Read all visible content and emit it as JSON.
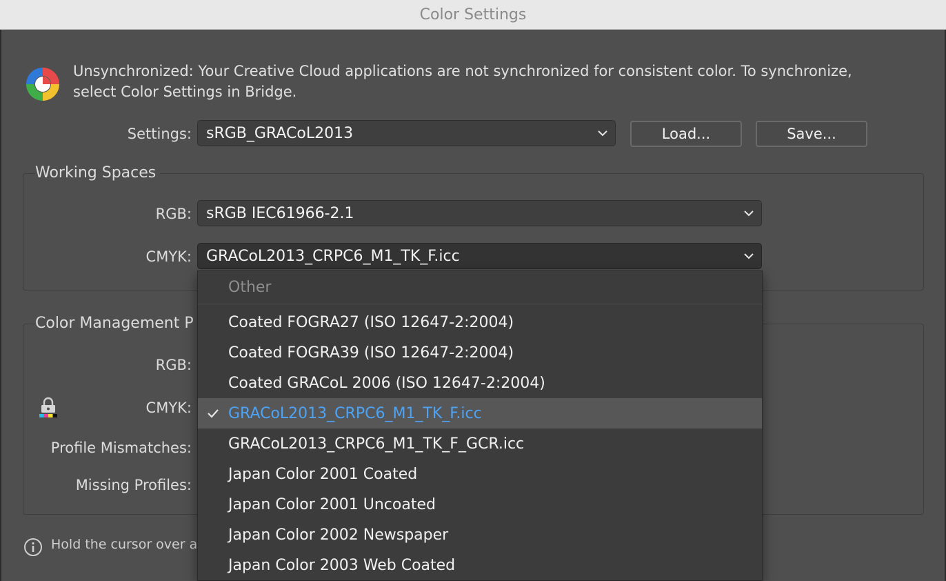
{
  "window": {
    "title": "Color Settings"
  },
  "sync": {
    "message": "Unsynchronized: Your Creative Cloud applications are not synchronized for consistent color. To synchronize, select Color Settings in Bridge."
  },
  "settings": {
    "label": "Settings:",
    "value": "sRGB_GRACoL2013",
    "load_label": "Load...",
    "save_label": "Save..."
  },
  "working_spaces": {
    "title": "Working Spaces",
    "rgb_label": "RGB:",
    "rgb_value": "sRGB IEC61966-2.1",
    "cmyk_label": "CMYK:",
    "cmyk_value": "GRACoL2013_CRPC6_M1_TK_F.icc"
  },
  "color_management": {
    "title": "Color Management P",
    "rgb_label": "RGB:",
    "cmyk_label": "CMYK:",
    "profile_mismatches_label": "Profile Mismatches:",
    "missing_profiles_label": "Missing Profiles:"
  },
  "info": {
    "text": "Hold the cursor over a"
  },
  "dropdown": {
    "header": "Other",
    "items": [
      {
        "label": "Coated FOGRA27 (ISO 12647-2:2004)",
        "selected": false
      },
      {
        "label": "Coated FOGRA39 (ISO 12647-2:2004)",
        "selected": false
      },
      {
        "label": "Coated GRACoL 2006 (ISO 12647-2:2004)",
        "selected": false
      },
      {
        "label": "GRACoL2013_CRPC6_M1_TK_F.icc",
        "selected": true
      },
      {
        "label": "GRACoL2013_CRPC6_M1_TK_F_GCR.icc",
        "selected": false
      },
      {
        "label": "Japan Color 2001 Coated",
        "selected": false
      },
      {
        "label": "Japan Color 2001 Uncoated",
        "selected": false
      },
      {
        "label": "Japan Color 2002 Newspaper",
        "selected": false
      },
      {
        "label": "Japan Color 2003 Web Coated",
        "selected": false
      }
    ]
  },
  "colors": {
    "selected_text": "#4ea3f5",
    "dialog_bg": "#4f4f4f",
    "menu_bg": "#3c3c3c",
    "selected_row_bg": "#575757"
  },
  "icons": {
    "sync": "color-sync-icon",
    "chevron": "chevron-down-icon",
    "check": "checkmark-icon",
    "lock": "lock-cmyk-icon",
    "info": "info-icon"
  }
}
